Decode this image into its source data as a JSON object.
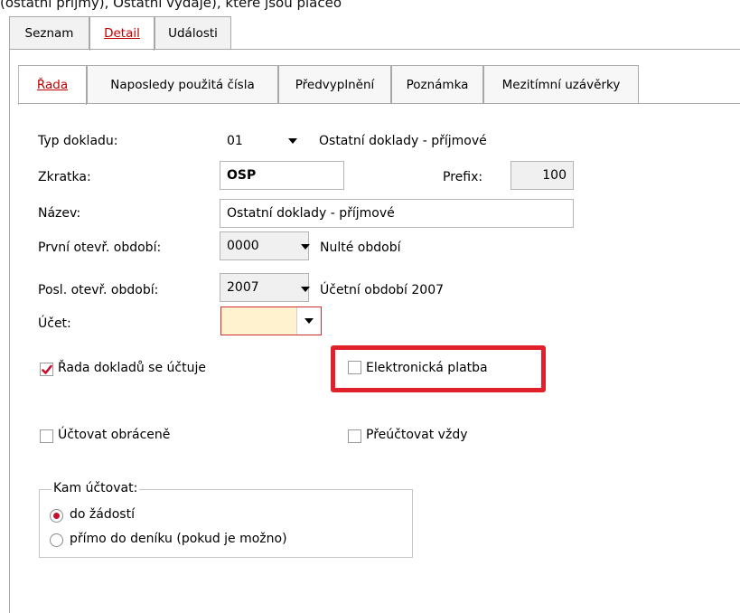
{
  "top_cut_text": "(ostatní příjmy), Ostatní výdaje), ktere jsou placeo",
  "outer_tabs": [
    {
      "label": "Seznam"
    },
    {
      "label": "Detail"
    },
    {
      "label": "Události"
    }
  ],
  "inner_tabs": [
    {
      "label": "Řada"
    },
    {
      "label": "Naposledy použitá čísla"
    },
    {
      "label": "Předvyplnění"
    },
    {
      "label": "Poznámka"
    },
    {
      "label": "Mezitímní uzávěrky"
    }
  ],
  "form": {
    "typ_dokladu": {
      "label": "Typ dokladu:",
      "value": "01",
      "description": "Ostatní doklady - příjmové"
    },
    "zkratka": {
      "label": "Zkratka:",
      "value": "OSP"
    },
    "prefix": {
      "label": "Prefix:",
      "value": "100"
    },
    "nazev": {
      "label": "Název:",
      "value": "Ostatní doklady - příjmové"
    },
    "prvni_obdobi": {
      "label": "První otevř. období:",
      "value": "0000",
      "description": "Nulté období"
    },
    "posl_obdobi": {
      "label": "Posl. otevř. období:",
      "value": "2007",
      "description": "Účetní období 2007"
    },
    "ucet": {
      "label": "Účet:",
      "value": ""
    }
  },
  "checkboxes": {
    "rada_uctuje": {
      "label": "Řada dokladů se účtuje",
      "checked": true
    },
    "elektronicka_platba": {
      "label": "Elektronická platba",
      "checked": false
    },
    "uctovat_obracene": {
      "label": "Účtovat obráceně",
      "checked": false
    },
    "preuctovat_vzdy": {
      "label": "Přeúčtovat vždy",
      "checked": false
    }
  },
  "kam_uctovat": {
    "title": "Kam účtovat:",
    "options": [
      {
        "label": "do žádostí",
        "selected": true
      },
      {
        "label": "přímo do deníku (pokud je možno)",
        "selected": false
      }
    ]
  },
  "colors": {
    "accent": "#c00000",
    "highlight": "#e0202a",
    "required_field": "#fff3cf"
  }
}
